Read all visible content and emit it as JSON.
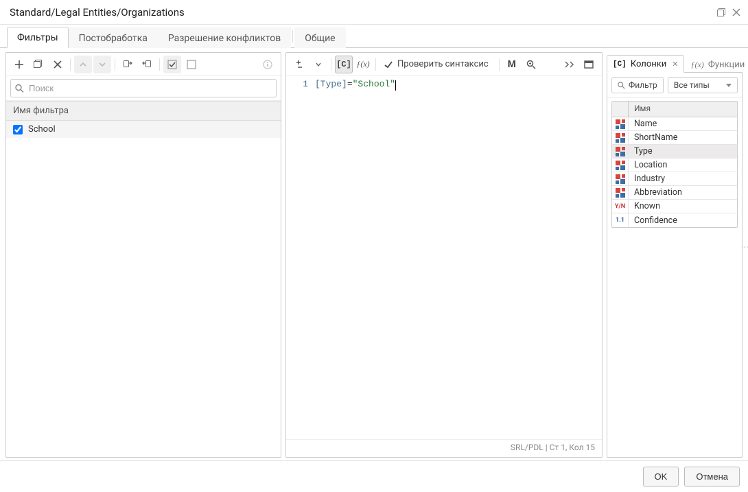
{
  "window": {
    "title": "Standard/Legal Entities/Organizations"
  },
  "topTabs": {
    "filters": "Фильтры",
    "postprocess": "Постобработка",
    "conflicts": "Разрешение конфликтов",
    "common": "Общие"
  },
  "left": {
    "search_placeholder": "Поиск",
    "filter_name_header": "Имя фильтра",
    "filters": [
      {
        "label": "School",
        "checked": true
      }
    ]
  },
  "editor": {
    "line_number": "1",
    "code_bracketed": "[Type]",
    "code_eq": "=",
    "code_string": "\"School\"",
    "check_syntax": "Проверить синтаксис",
    "status": "SRL/PDL | Ст 1, Кол 15",
    "btn_C": "[C]",
    "btn_fx": "ƒ(x)",
    "btn_M": "M"
  },
  "right": {
    "tab_columns": "Колонки",
    "tab_functions": "Функции",
    "filter_btn": "Фильтр",
    "types_sel": "Все типы",
    "col_name_header": "Имя",
    "columns": [
      {
        "name": "Name",
        "kind": "text"
      },
      {
        "name": "ShortName",
        "kind": "text"
      },
      {
        "name": "Type",
        "kind": "text",
        "selected": true
      },
      {
        "name": "Location",
        "kind": "text"
      },
      {
        "name": "Industry",
        "kind": "text"
      },
      {
        "name": "Abbreviation",
        "kind": "text"
      },
      {
        "name": "Known",
        "kind": "known"
      },
      {
        "name": "Confidence",
        "kind": "num"
      }
    ]
  },
  "footer": {
    "ok": "OK",
    "cancel": "Отмена"
  }
}
